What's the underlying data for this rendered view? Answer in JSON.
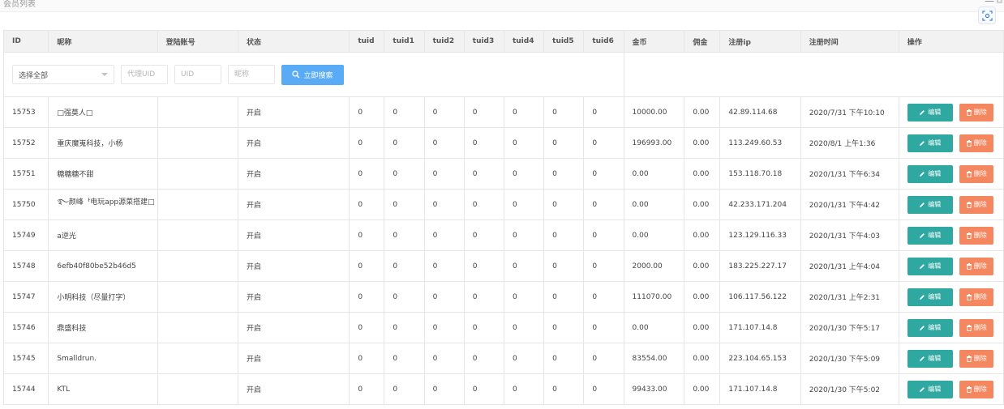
{
  "page": {
    "title": "会员列表"
  },
  "window": {
    "minimize": "—",
    "maximize": "⧉"
  },
  "icons": {
    "scan": "scan-icon",
    "search": "search-icon",
    "edit": "pencil-icon",
    "delete": "trash-icon"
  },
  "colors": {
    "search_button": "#5aabf5",
    "edit_button": "#2ea8a0",
    "delete_button": "#f4875f",
    "status_on": "#5fb878",
    "header_bg": "#f2f2f2"
  },
  "table": {
    "headers": [
      "ID",
      "昵称",
      "登陆账号",
      "状态",
      "tuid",
      "tuid1",
      "tuid2",
      "tuid3",
      "tuid4",
      "tuid5",
      "tuid6",
      "金币",
      "佣金",
      "注册ip",
      "注册时间",
      "操作"
    ],
    "filters": {
      "select_value": "选择全部",
      "agent_uid_placeholder": "代理UID",
      "uid_placeholder": "UID",
      "nickname_placeholder": "昵称",
      "search_label": "立即搜索"
    },
    "edit_label": "编辑",
    "delete_label": "删除",
    "rows": [
      {
        "id": "15753",
        "nickname": "□强莫人□",
        "account": "",
        "status": "开启",
        "tuid": "0",
        "tuid1": "0",
        "tuid2": "0",
        "tuid3": "0",
        "tuid4": "0",
        "tuid5": "0",
        "tuid6": "0",
        "coins": "10000.00",
        "commission": "0.00",
        "ip": "42.89.114.68",
        "time": "2020/7/31 下午10:10"
      },
      {
        "id": "15752",
        "nickname": "重庆魔嵬科技，小杨",
        "account": "",
        "status": "开启",
        "tuid": "0",
        "tuid1": "0",
        "tuid2": "0",
        "tuid3": "0",
        "tuid4": "0",
        "tuid5": "0",
        "tuid6": "0",
        "coins": "196993.00",
        "commission": "0.00",
        "ip": "113.249.60.53",
        "time": "2020/8/1 上午1:36"
      },
      {
        "id": "15751",
        "nickname": "糖糖糖不甜",
        "account": "",
        "status": "开启",
        "tuid": "0",
        "tuid1": "0",
        "tuid2": "0",
        "tuid3": "0",
        "tuid4": "0",
        "tuid5": "0",
        "tuid6": "0",
        "coins": "0.00",
        "commission": "0.00",
        "ip": "153.118.70.18",
        "time": "2020/1/31 下午6:34"
      },
      {
        "id": "15750",
        "nickname": "࿐颜峰ᅡ电玩app源菜搭建□",
        "account": "",
        "status": "开启",
        "tuid": "0",
        "tuid1": "0",
        "tuid2": "0",
        "tuid3": "0",
        "tuid4": "0",
        "tuid5": "0",
        "tuid6": "0",
        "coins": "0.00",
        "commission": "0.00",
        "ip": "42.233.171.204",
        "time": "2020/1/31 下午4:42"
      },
      {
        "id": "15749",
        "nickname": "a逆光",
        "account": "",
        "status": "开启",
        "tuid": "0",
        "tuid1": "0",
        "tuid2": "0",
        "tuid3": "0",
        "tuid4": "0",
        "tuid5": "0",
        "tuid6": "0",
        "coins": "0.00",
        "commission": "0.00",
        "ip": "123.129.116.33",
        "time": "2020/1/31 下午4:03"
      },
      {
        "id": "15748",
        "nickname": "6efb40f80be52b46d5",
        "account": "",
        "status": "开启",
        "tuid": "0",
        "tuid1": "0",
        "tuid2": "0",
        "tuid3": "0",
        "tuid4": "0",
        "tuid5": "0",
        "tuid6": "0",
        "coins": "2000.00",
        "commission": "0.00",
        "ip": "183.225.227.17",
        "time": "2020/1/31 上午4:04"
      },
      {
        "id": "15747",
        "nickname": "小明科技（尽量打字）",
        "account": "",
        "status": "开启",
        "tuid": "0",
        "tuid1": "0",
        "tuid2": "0",
        "tuid3": "0",
        "tuid4": "0",
        "tuid5": "0",
        "tuid6": "0",
        "coins": "111070.00",
        "commission": "0.00",
        "ip": "106.117.56.122",
        "time": "2020/1/31 上午2:31"
      },
      {
        "id": "15746",
        "nickname": "鼎盛科技",
        "account": "",
        "status": "开启",
        "tuid": "0",
        "tuid1": "0",
        "tuid2": "0",
        "tuid3": "0",
        "tuid4": "0",
        "tuid5": "0",
        "tuid6": "0",
        "coins": "0.00",
        "commission": "0.00",
        "ip": "171.107.14.8",
        "time": "2020/1/30 下午5:17"
      },
      {
        "id": "15745",
        "nickname": "Smalldrun.",
        "account": "",
        "status": "开启",
        "tuid": "0",
        "tuid1": "0",
        "tuid2": "0",
        "tuid3": "0",
        "tuid4": "0",
        "tuid5": "0",
        "tuid6": "0",
        "coins": "83554.00",
        "commission": "0.00",
        "ip": "223.104.65.153",
        "time": "2020/1/30 下午5:09"
      },
      {
        "id": "15744",
        "nickname": "KTL",
        "account": "",
        "status": "开启",
        "tuid": "0",
        "tuid1": "0",
        "tuid2": "0",
        "tuid3": "0",
        "tuid4": "0",
        "tuid5": "0",
        "tuid6": "0",
        "coins": "99433.00",
        "commission": "0.00",
        "ip": "171.107.14.8",
        "time": "2020/1/30 下午5:02"
      }
    ]
  }
}
